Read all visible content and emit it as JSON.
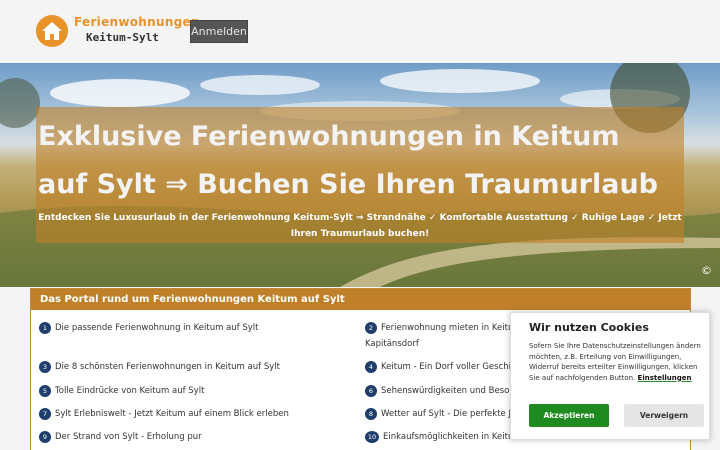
{
  "header": {
    "logo_line1": "Ferienwohnungen",
    "logo_line2": "Keitum-Sylt",
    "login_label": "Anmelden"
  },
  "hero": {
    "title": "Exklusive Ferienwohnungen in Keitum auf Sylt ⇒ Buchen Sie Ihren Traumurlaub",
    "subtitle": "Entdecken Sie Luxusurlaub in der Ferienwohnung Keitum-Sylt ⇒ Strandnähe ✓ Komfortable Ausstattung ✓ Ruhige Lage ✓ Jetzt Ihren Traumurlaub buchen!",
    "copyright": "©"
  },
  "portal": {
    "heading": "Das Portal rund um Ferienwohnungen Keitum auf Sylt",
    "items": [
      {
        "num": "1",
        "text": "Die passende Ferienwohnung in Keitum auf Sylt"
      },
      {
        "num": "2",
        "text": "Ferienwohnung mieten in Keitum",
        "text2": "Kapitänsdorf"
      },
      {
        "num": "3",
        "text": "Die 8 schönsten Ferienwohnungen in Keitum auf Sylt"
      },
      {
        "num": "4",
        "text": "Keitum - Ein Dorf voller Geschicht"
      },
      {
        "num": "5",
        "text": "Tolle Eindrücke von Keitum auf Sylt"
      },
      {
        "num": "6",
        "text": "Sehenswürdigkeiten und Besonde"
      },
      {
        "num": "7",
        "text": "Sylt Erlebniswelt - Jetzt Keitum auf einem Blick erleben"
      },
      {
        "num": "8",
        "text": "Wetter auf Sylt - Die perfekte Jahr"
      },
      {
        "num": "9",
        "text": "Der Strand von Sylt - Erholung pur"
      },
      {
        "num": "10",
        "text": "Einkaufsmöglichkeiten in Keitum"
      }
    ]
  },
  "cookie": {
    "title": "Wir nutzen Cookies",
    "text": "Sofern Sie Ihre Datenschutzeinstellungen ändern möchten, z.B. Erteilung von Einwilligungen, Widerruf bereits erteilter Einwilligungen, klicken Sie auf nachfolgenden Button.",
    "link": "Einstellungen",
    "accept": "Akzeptieren",
    "decline": "Verweigern"
  },
  "colors": {
    "accent": "#c0802a",
    "accept_green": "#1f8a1f",
    "number_badge": "#1e3f6b"
  }
}
